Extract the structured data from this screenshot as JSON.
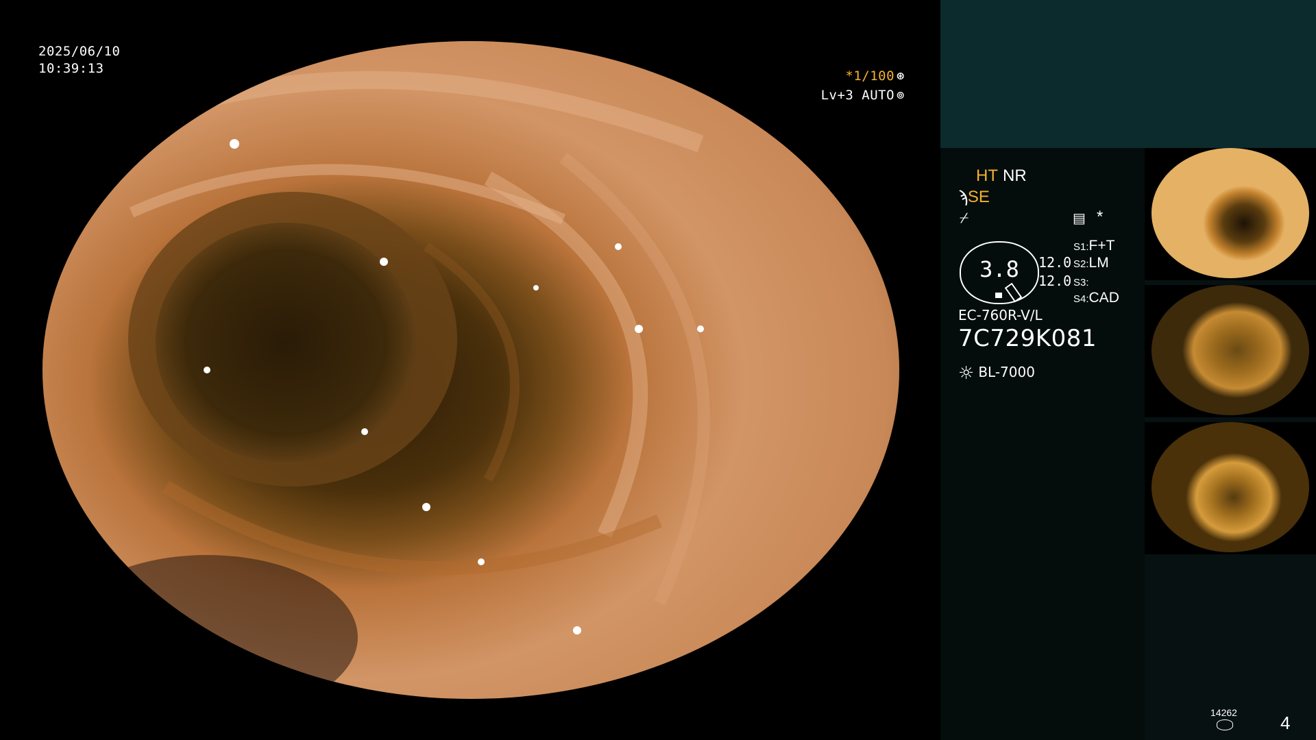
{
  "overlay": {
    "date": "2025/06/10",
    "time": "10:39:13",
    "shutter": "*1/100",
    "shutter_icon": "aperture-icon",
    "level": "Lv+3 AUTO",
    "level_icon": "iris-icon"
  },
  "panel": {
    "ht": "HT",
    "nr": "NR",
    "se_prefix": "ϡ",
    "se": "SE",
    "flash_glyph": "⌿",
    "memo_glyph": "▤",
    "star_glyph": "*",
    "gauge_value": "3.8",
    "value_a": "12.0",
    "value_b": "12.0",
    "slots": [
      {
        "key": "S1:",
        "value": "F+T"
      },
      {
        "key": "S2:",
        "value": "LM"
      },
      {
        "key": "S3:",
        "value": ""
      },
      {
        "key": "S4:",
        "value": "CAD"
      }
    ],
    "model": "EC-760R-V/L",
    "serial": "7C729K081",
    "light_glyph": "☼",
    "light_source": "BL-7000",
    "counter": "14262",
    "page_number": "4"
  },
  "colors": {
    "accent": "#f5b230",
    "panel_bg": "#071112",
    "panel_band": "#0b2b2c"
  }
}
